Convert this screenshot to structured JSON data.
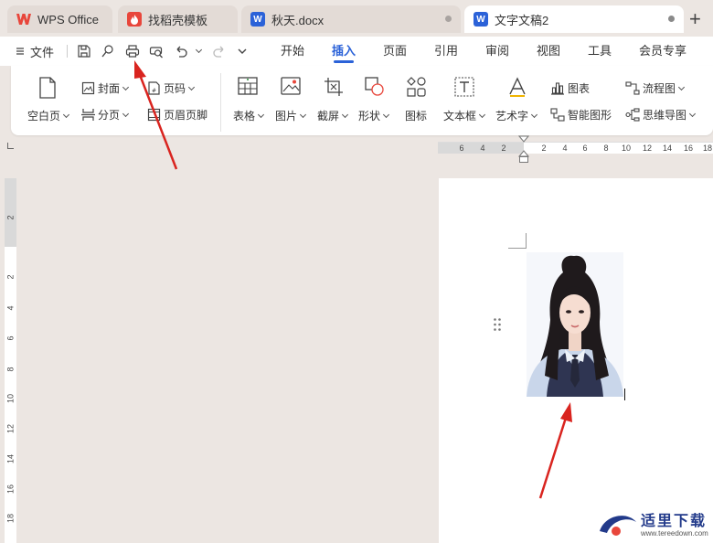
{
  "tabs": [
    {
      "label": "WPS Office",
      "icon": "wps-logo-icon"
    },
    {
      "label": "找稻壳模板",
      "icon": "docer-icon"
    },
    {
      "label": "秋天.docx",
      "icon": "word-doc-icon"
    },
    {
      "label": "文字文稿2",
      "icon": "word-doc-icon"
    }
  ],
  "menubar": {
    "file_label": "文件",
    "tabs": [
      "开始",
      "插入",
      "页面",
      "引用",
      "审阅",
      "视图",
      "工具",
      "会员专享"
    ],
    "active_tab": "插入"
  },
  "ribbon": {
    "cover": "封面",
    "page_number": "页码",
    "blank_page": "空白页",
    "page_break": "分页",
    "header_footer": "页眉页脚",
    "table": "表格",
    "picture": "图片",
    "screenshot": "截屏",
    "shape": "形状",
    "icon": "图标",
    "textbox": "文本框",
    "wordart": "艺术字",
    "chart": "图表",
    "smart_graphic": "智能图形",
    "flowchart": "流程图",
    "mindmap": "思维导图"
  },
  "hruler_numbers": [
    "6",
    "4",
    "2",
    "2",
    "4",
    "6",
    "8",
    "10",
    "12",
    "14",
    "16",
    "18"
  ],
  "vruler_numbers": [
    "2",
    "2",
    "4",
    "6",
    "8",
    "10",
    "12",
    "14",
    "16",
    "18"
  ],
  "watermark": {
    "text": "适里下载",
    "url": "www.tereedown.com"
  },
  "colors": {
    "accent": "#2b62d8",
    "arrow": "#d9241f",
    "wps_red": "#e8463b",
    "word_blue": "#2b62d8"
  }
}
